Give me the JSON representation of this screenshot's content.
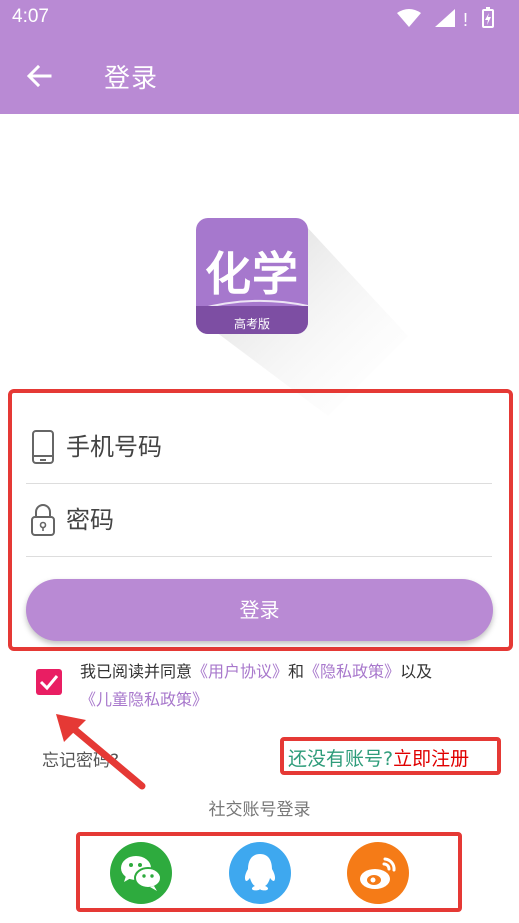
{
  "status_bar": {
    "time": "4:07"
  },
  "app_bar": {
    "title": "登录",
    "back_icon": "arrow-left-icon"
  },
  "logo": {
    "title": "化学",
    "subtitle": "高考版"
  },
  "form": {
    "phone_placeholder": "手机号码",
    "password_placeholder": "密码",
    "login_label": "登录"
  },
  "agreement": {
    "checked": true,
    "prefix": "我已阅读并同意",
    "user_agreement": "《用户协议》",
    "and": "和",
    "privacy_policy": "《隐私政策》",
    "and_also": "以及",
    "child_privacy": "《儿童隐私政策》"
  },
  "links": {
    "forgot": "忘记密码?",
    "no_account": "还没有账号?",
    "register_now": "立即注册"
  },
  "social": {
    "label": "社交账号登录",
    "items": [
      {
        "name": "wechat",
        "icon": "wechat-icon",
        "color": "#2eab3e"
      },
      {
        "name": "qq",
        "icon": "qq-icon",
        "color": "#3ea8ef"
      },
      {
        "name": "weibo",
        "icon": "weibo-icon",
        "color": "#f57b17"
      }
    ]
  },
  "colors": {
    "primary": "#b98ad4",
    "accent": "#e91e63",
    "annotation": "#e53935"
  }
}
